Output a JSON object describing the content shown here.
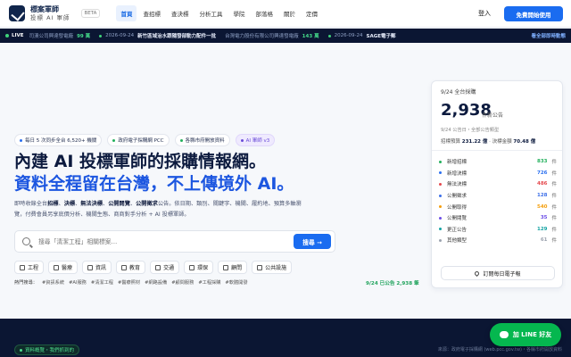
{
  "header": {
    "logo_title": "標案軍師",
    "logo_sub": "投標 AI 軍師",
    "beta": "BETA",
    "nav": [
      "首頁",
      "查招標",
      "查決標",
      "分析工具",
      "學院",
      "部落格",
      "關於",
      "定價"
    ],
    "login": "登入",
    "cta": "免費開始使用"
  },
  "ticker": {
    "live": "LIVE",
    "items": [
      {
        "text": "司澳公司興達發電廠",
        "num": "99 萬",
        "date": ""
      },
      {
        "text": "新竹區域治水跟隨發部動力配件一批",
        "num": "",
        "date": "2026-09-24"
      },
      {
        "text": "台灣電力股份有限公司興達發電廠",
        "num": "143 萬",
        "date": ""
      },
      {
        "text": "SAGE電子郵",
        "num": "",
        "date": "2026-09-24"
      }
    ],
    "link": "看全部即時動態"
  },
  "hero": {
    "badges": [
      "每日 5 次同步全台 6,520+ 機關",
      "政府電子採購網 PCC",
      "各縣市府開放資料",
      "AI 軍師 v3"
    ],
    "title_line1": "內建 AI 投標軍師的採購情報網。",
    "title_line2": "資料全程留在台灣，不上傳境外 AI。",
    "desc_parts": [
      "即時收錄全台",
      "招標",
      "、",
      "決標",
      "、",
      "無法決標",
      "、",
      "公開閱覽",
      "、",
      "公開徵求",
      "公告。依日期、類別、關鍵字、機關、履約地、預算多軸瀏覽，付費會員另享底價分析、機關生態、商商對手分析 + AI 投標軍師。"
    ],
    "search_placeholder": "搜尋「清潔工程」相關標案…",
    "search_btn": "搜尋 →",
    "categories": [
      "工程",
      "醫療",
      "資訊",
      "教育",
      "交通",
      "環保",
      "顧問",
      "公共設施"
    ],
    "hot_label": "熱門搜尋：",
    "hot_tags": [
      "#資訊系統",
      "#AI服務",
      "#清潔工程",
      "#醫療照材",
      "#網路設備",
      "#顧問服務",
      "#工程採購",
      "#軟體開發"
    ],
    "hot_right": "9/24 已公告 2,938 筆"
  },
  "card": {
    "head": "9/24 全台採購",
    "big": "2,938",
    "unit": "件新公告",
    "sub": "9/24 公告日・全部公告類型",
    "budget_label": "招標預算",
    "budget": "231.22 億",
    "award_label": "決標金額",
    "award": "70.48 億",
    "rows": [
      {
        "label": "新增招標",
        "value": "833",
        "color": "#22b05c"
      },
      {
        "label": "新增決標",
        "value": "726",
        "color": "#2a6ff0"
      },
      {
        "label": "無法決標",
        "value": "486",
        "color": "#e5484d"
      },
      {
        "label": "公開徵求",
        "value": "128",
        "color": "#3b6ee8"
      },
      {
        "label": "公開取得",
        "value": "540",
        "color": "#f59e0b"
      },
      {
        "label": "公開閱覽",
        "value": "35",
        "color": "#6b4de6"
      },
      {
        "label": "更正公告",
        "value": "129",
        "color": "#14a3a3"
      },
      {
        "label": "其他類型",
        "value": "61",
        "color": "#9ca3af"
      }
    ],
    "unit_small": "件",
    "subscribe": "訂閱每日電子報"
  },
  "footer": {
    "chip": "資料概覽・我們抓到的",
    "source": "來源：政府電子採購網 (web.pcc.gov.tw)・各縣市府開放資料",
    "line_btn": "加 LINE 好友"
  },
  "colors": {
    "accent": "#1a6cf0",
    "dark": "#0b1633",
    "line": "#05b74f"
  }
}
